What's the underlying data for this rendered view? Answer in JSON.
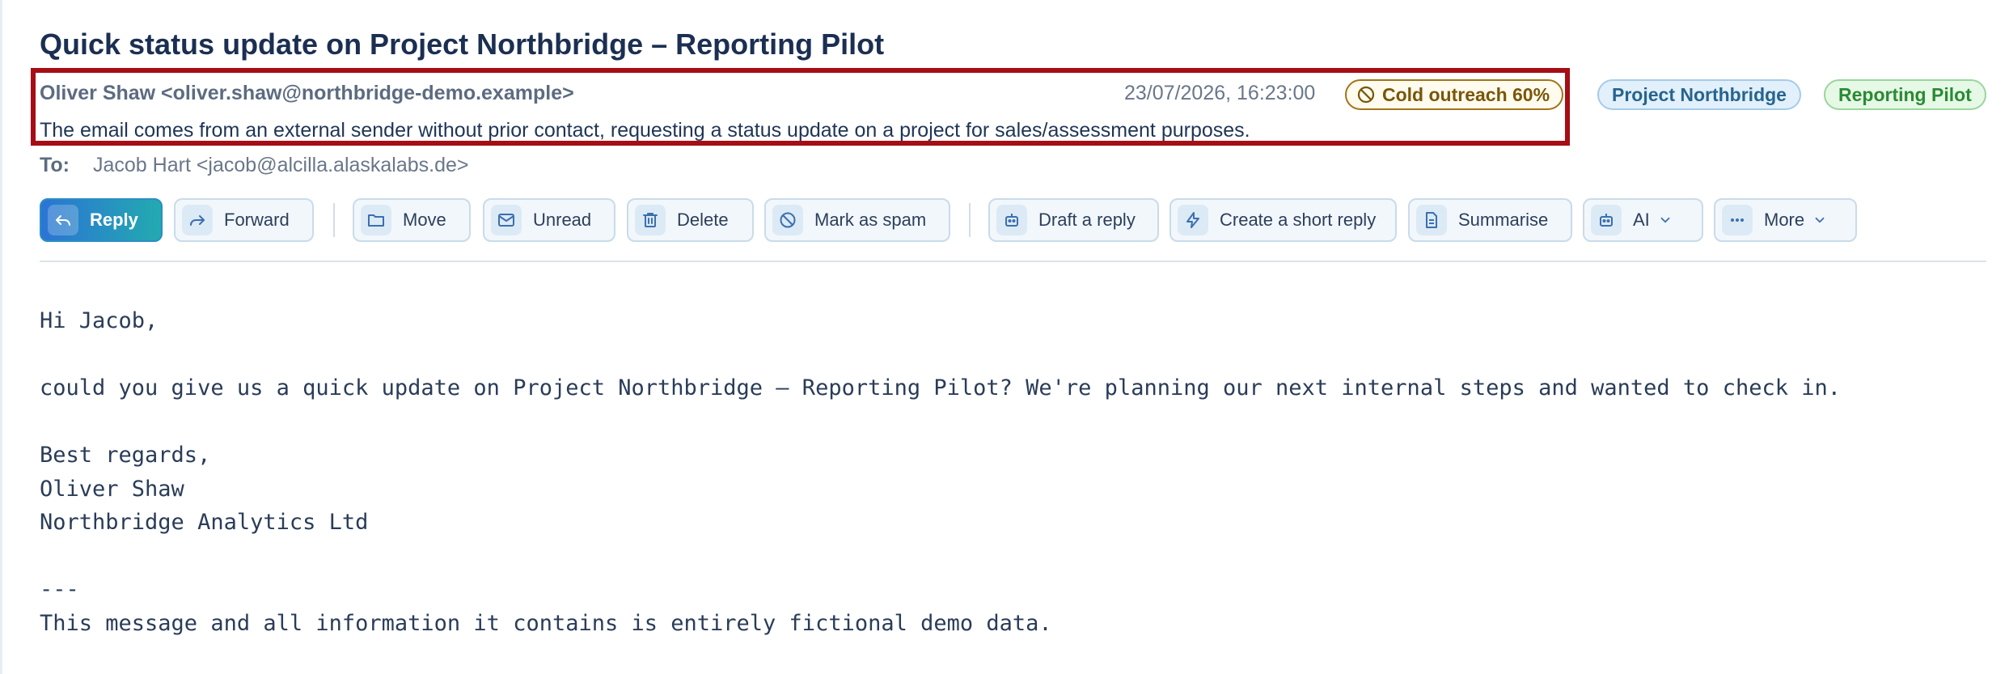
{
  "email": {
    "subject": "Quick status update on Project Northbridge – Reporting Pilot",
    "from": "Oliver Shaw <oliver.shaw@northbridge-demo.example>",
    "date": "23/07/2026, 16:23:00",
    "classification": {
      "label": "Cold outreach 60%",
      "icon": "block-icon",
      "color": "#a2741a"
    },
    "tags": [
      {
        "label": "Project Northbridge",
        "color": "#27648e"
      },
      {
        "label": "Reporting Pilot",
        "color": "#2a8a33"
      }
    ],
    "summary": "The email comes from an external sender without prior contact, requesting a status update on a project for sales/assessment purposes.",
    "to_label": "To:",
    "to": "Jacob Hart <jacob@alcilla.alaskalabs.de>",
    "body": "Hi Jacob,\n\ncould you give us a quick update on Project Northbridge – Reporting Pilot? We're planning our next internal steps and wanted to check in.\n\nBest regards,\nOliver Shaw\nNorthbridge Analytics Ltd\n\n---\nThis message and all information it contains is entirely fictional demo data."
  },
  "toolbar": {
    "reply": "Reply",
    "forward": "Forward",
    "move": "Move",
    "unread": "Unread",
    "delete": "Delete",
    "spam": "Mark as spam",
    "draft": "Draft a reply",
    "short_reply": "Create a short reply",
    "summarise": "Summarise",
    "ai": "AI",
    "more": "More"
  },
  "colors": {
    "highlight_border": "#a60d14",
    "primary_gradient_start": "#2b74d4",
    "primary_gradient_end": "#23aab0",
    "subject": "#1b2f52"
  }
}
